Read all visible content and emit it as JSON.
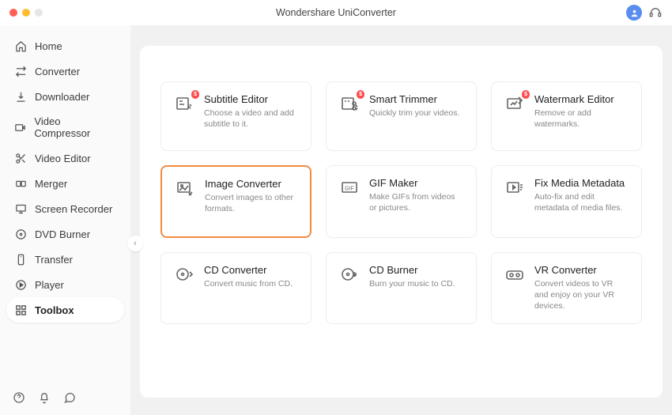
{
  "titlebar": {
    "title": "Wondershare UniConverter"
  },
  "sidebar": {
    "items": [
      {
        "label": "Home"
      },
      {
        "label": "Converter"
      },
      {
        "label": "Downloader"
      },
      {
        "label": "Video Compressor"
      },
      {
        "label": "Video Editor"
      },
      {
        "label": "Merger"
      },
      {
        "label": "Screen Recorder"
      },
      {
        "label": "DVD Burner"
      },
      {
        "label": "Transfer"
      },
      {
        "label": "Player"
      },
      {
        "label": "Toolbox"
      }
    ]
  },
  "tools": [
    {
      "title": "Subtitle Editor",
      "desc": "Choose a video and add subtitle to it.",
      "badge": "$"
    },
    {
      "title": "Smart Trimmer",
      "desc": "Quickly trim your videos.",
      "badge": "$"
    },
    {
      "title": "Watermark Editor",
      "desc": "Remove or add watermarks.",
      "badge": "$"
    },
    {
      "title": "Image Converter",
      "desc": "Convert images to other formats.",
      "badge": ""
    },
    {
      "title": "GIF Maker",
      "desc": "Make GIFs from videos or pictures.",
      "badge": ""
    },
    {
      "title": "Fix Media Metadata",
      "desc": "Auto-fix and edit metadata of media files.",
      "badge": ""
    },
    {
      "title": "CD Converter",
      "desc": "Convert music from CD.",
      "badge": ""
    },
    {
      "title": "CD Burner",
      "desc": "Burn your music to CD.",
      "badge": ""
    },
    {
      "title": "VR Converter",
      "desc": "Convert videos to VR and enjoy on your VR devices.",
      "badge": ""
    }
  ]
}
